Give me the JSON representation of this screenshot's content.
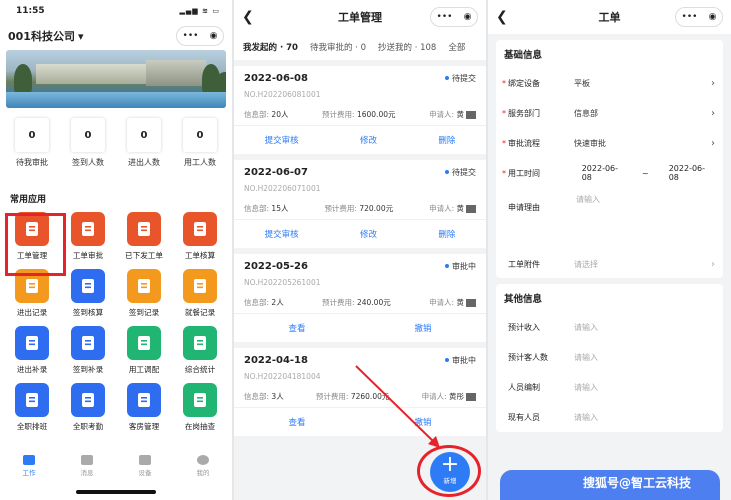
{
  "status": {
    "time": "11:55",
    "icons": "▂▄▆ ≋ ▭"
  },
  "home": {
    "company": "001科技公司",
    "stats": [
      {
        "value": "0",
        "label": "待我审批"
      },
      {
        "value": "0",
        "label": "签到人数"
      },
      {
        "value": "0",
        "label": "进出人数"
      },
      {
        "value": "0",
        "label": "用工人数"
      }
    ],
    "section": "常用应用",
    "apps": [
      {
        "label": "工单管理",
        "icon": "work-order-icon",
        "color": "#e8552b"
      },
      {
        "label": "工单审批",
        "icon": "approval-icon",
        "color": "#e8552b"
      },
      {
        "label": "已下发工单",
        "icon": "issued-order-icon",
        "color": "#e8552b"
      },
      {
        "label": "工单核算",
        "icon": "calc-icon",
        "color": "#e8552b"
      },
      {
        "label": "进出记录",
        "icon": "access-record-icon",
        "color": "#f39a1e"
      },
      {
        "label": "签到核算",
        "icon": "checkin-calc-icon",
        "color": "#2e6df0"
      },
      {
        "label": "签到记录",
        "icon": "checkin-record-icon",
        "color": "#f39a1e"
      },
      {
        "label": "就餐记录",
        "icon": "meal-icon",
        "color": "#f39a1e"
      },
      {
        "label": "进出补录",
        "icon": "access-supplement-icon",
        "color": "#2e6df0"
      },
      {
        "label": "签到补录",
        "icon": "checkin-supplement-icon",
        "color": "#2e6df0"
      },
      {
        "label": "用工调配",
        "icon": "dispatch-icon",
        "color": "#21b573"
      },
      {
        "label": "综合统计",
        "icon": "stats-icon",
        "color": "#21b573"
      },
      {
        "label": "全职排班",
        "icon": "schedule-icon",
        "color": "#2e6df0"
      },
      {
        "label": "全职考勤",
        "icon": "attendance-icon",
        "color": "#2e6df0"
      },
      {
        "label": "客房管理",
        "icon": "room-icon",
        "color": "#2e6df0"
      },
      {
        "label": "在岗抽查",
        "icon": "spot-check-icon",
        "color": "#21b573"
      }
    ],
    "tabs": [
      "工作",
      "消息",
      "设备",
      "我的"
    ]
  },
  "orders": {
    "title": "工单管理",
    "tabs": [
      "我发起的 · 70",
      "待我审批的 · 0",
      "抄送我的 · 108",
      "全部"
    ],
    "info_labels": {
      "dept": "信息部:",
      "cost": "预计费用:",
      "applicant": "申请人:"
    },
    "cards": [
      {
        "date": "2022-06-08",
        "status": "待提交",
        "no": "NO.H202206081001",
        "people": "20人",
        "cost": "1600.00元",
        "applicant": "黄",
        "actions": [
          "提交审核",
          "修改",
          "删除"
        ]
      },
      {
        "date": "2022-06-07",
        "status": "待提交",
        "no": "NO.H202206071001",
        "people": "15人",
        "cost": "720.00元",
        "applicant": "黄",
        "actions": [
          "提交审核",
          "修改",
          "删除"
        ]
      },
      {
        "date": "2022-05-26",
        "status": "审批中",
        "no": "NO.H202205261001",
        "people": "2人",
        "cost": "240.00元",
        "applicant": "黄",
        "actions": [
          "查看",
          "撤销"
        ]
      },
      {
        "date": "2022-04-18",
        "status": "审批中",
        "no": "NO.H202204181004",
        "people": "3人",
        "cost": "7260.00元",
        "applicant": "黄彤",
        "actions": [
          "查看",
          "撤销"
        ]
      }
    ],
    "fab_label": "新增"
  },
  "form": {
    "title": "工单",
    "basic_title": "基础信息",
    "device_label": "绑定设备",
    "device_value": "平板",
    "dept_label": "服务部门",
    "dept_value": "信息部",
    "flow_label": "审批流程",
    "flow_value": "快速审批",
    "time_label": "用工时间",
    "time_start": "2022-06-08",
    "time_sep": "~",
    "time_end": "2022-06-08",
    "reason_label": "申请理由",
    "reason_placeholder": "请输入",
    "attach_label": "工单附件",
    "attach_placeholder": "请选择",
    "other_title": "其他信息",
    "income_label": "预计收入",
    "income_placeholder": "请输入",
    "guests_label": "预计客人数",
    "guests_placeholder": "请输入",
    "staff_label": "人员编制",
    "staff_placeholder": "请输入",
    "current_label": "现有人员",
    "current_placeholder": "请输入"
  },
  "watermark": "搜狐号@智工云科技"
}
